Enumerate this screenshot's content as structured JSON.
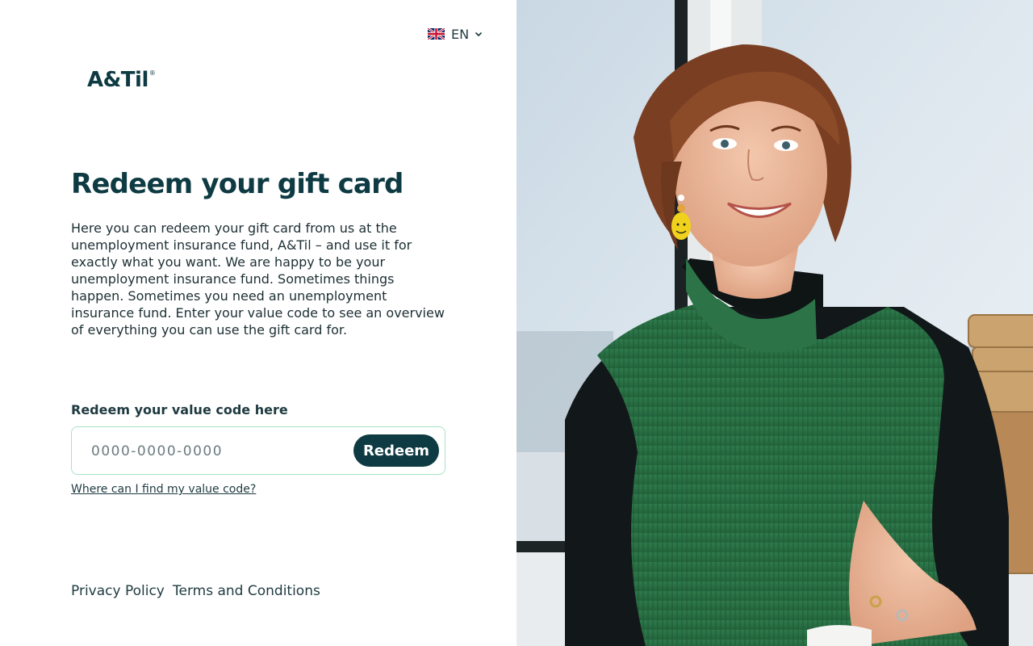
{
  "language": {
    "code": "EN",
    "flag": "uk-flag-icon"
  },
  "brand": {
    "logo_text": "A&Til",
    "registered_mark": "®"
  },
  "main": {
    "title": "Redeem your gift card",
    "intro": "Here you can redeem your gift card from us at the unemployment insurance fund, A&Til – and use it for exactly what you want. We are happy to be your unemployment insurance fund. Sometimes things happen. Sometimes you need an unemployment insurance fund. Enter your value code to see an overview of everything you can use the gift card for.",
    "code_label": "Redeem your value code here",
    "code_placeholder": "0000-0000-0000",
    "redeem_label": "Redeem",
    "help_link": "Where can I find my value code?"
  },
  "footer": {
    "privacy": "Privacy Policy",
    "terms": "Terms and Conditions"
  },
  "colors": {
    "brand_dark": "#0e3b43",
    "input_border": "#a9e3c3",
    "text": "#1d2f33"
  }
}
